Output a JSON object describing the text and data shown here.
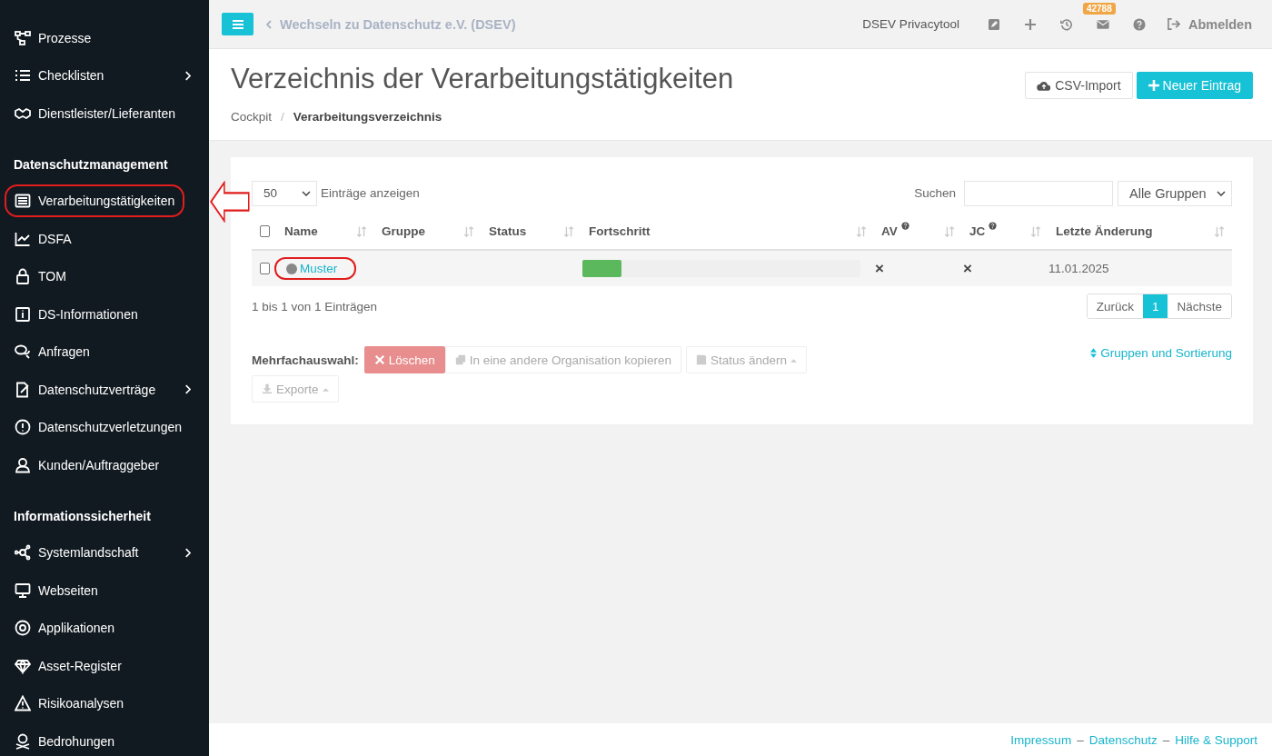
{
  "sidebar": {
    "sections": [
      {
        "items": [
          {
            "label": "Prozesse",
            "submenu": false,
            "highlighted": false
          },
          {
            "label": "Checklisten",
            "submenu": true,
            "highlighted": false
          },
          {
            "label": "Dienstleister/Lieferanten",
            "submenu": false,
            "highlighted": false
          }
        ]
      },
      {
        "heading": "Datenschutzmanagement",
        "items": [
          {
            "label": "Verarbeitungstätigkeiten",
            "submenu": false,
            "highlighted": true
          },
          {
            "label": "DSFA",
            "submenu": false,
            "highlighted": false
          },
          {
            "label": "TOM",
            "submenu": false,
            "highlighted": false
          },
          {
            "label": "DS-Informationen",
            "submenu": false,
            "highlighted": false
          },
          {
            "label": "Anfragen",
            "submenu": false,
            "highlighted": false
          },
          {
            "label": "Datenschutzverträge",
            "submenu": true,
            "highlighted": false
          },
          {
            "label": "Datenschutzverletzungen",
            "submenu": false,
            "highlighted": false
          },
          {
            "label": "Kunden/Auftraggeber",
            "submenu": false,
            "highlighted": false
          }
        ]
      },
      {
        "heading": "Informationssicherheit",
        "items": [
          {
            "label": "Systemlandschaft",
            "submenu": true,
            "highlighted": false
          },
          {
            "label": "Webseiten",
            "submenu": false,
            "highlighted": false
          },
          {
            "label": "Applikationen",
            "submenu": false,
            "highlighted": false
          },
          {
            "label": "Asset-Register",
            "submenu": false,
            "highlighted": false
          },
          {
            "label": "Risikoanalysen",
            "submenu": false,
            "highlighted": false
          },
          {
            "label": "Bedrohungen",
            "submenu": false,
            "highlighted": false
          }
        ]
      }
    ]
  },
  "topbar": {
    "back_link": "Wechseln zu Datenschutz e.V. (DSEV)",
    "app_name": "DSEV Privacytool",
    "mail_badge": "42788",
    "logout": "Abmelden"
  },
  "page": {
    "title": "Verzeichnis der Verarbeitungstätigkeiten",
    "breadcrumb": [
      {
        "label": "Cockpit",
        "kind": "link",
        "current": false
      },
      {
        "label": "/",
        "kind": "separator"
      },
      {
        "label": "Verarbeitungsverzeichnis",
        "kind": "link",
        "current": true
      }
    ],
    "actions": [
      {
        "label": "CSV-Import",
        "kind": "secondary"
      },
      {
        "label": "Neuer Eintrag",
        "kind": "primary"
      }
    ]
  },
  "table_controls": {
    "page_size": "50",
    "page_size_label": "Einträge anzeigen",
    "search_label": "Suchen",
    "group_filter": "Alle Gruppen"
  },
  "table": {
    "select_all_checked": false,
    "columns": [
      {
        "label": "Name",
        "help": false
      },
      {
        "label": "Gruppe",
        "help": false
      },
      {
        "label": "Status",
        "help": false
      },
      {
        "label": "Fortschritt",
        "help": false
      },
      {
        "label": "AV",
        "help": true
      },
      {
        "label": "JC",
        "help": true
      },
      {
        "label": "Letzte Änderung",
        "help": false
      }
    ],
    "rows": [
      {
        "checked": false,
        "color": "#888888",
        "name": "Muster",
        "highlighted": true,
        "level": 0.14,
        "av": "×",
        "jc": "×",
        "changed": "11.01.2025"
      }
    ]
  },
  "info": "1 bis 1 von 1 Einträgen",
  "pagination": [
    {
      "label": "Zurück",
      "selected": false
    },
    {
      "label": "1",
      "selected": true
    },
    {
      "label": "Nächste",
      "selected": false
    }
  ],
  "bulk": {
    "label": "Mehrfachauswahl:",
    "actions": [
      {
        "label": "Löschen",
        "kind": "danger",
        "dropdown": false
      },
      {
        "label": "In eine andere Organisation kopieren",
        "kind": "disabled",
        "dropdown": false
      },
      {
        "label": "Status ändern",
        "kind": "disabled",
        "dropdown": true
      },
      {
        "label": "Exporte",
        "kind": "disabled",
        "dropdown": true
      }
    ]
  },
  "group_sort_link": "Gruppen und Sortierung",
  "footer": [
    {
      "label": "Impressum",
      "kind": "link"
    },
    {
      "label": "–",
      "kind": "separator"
    },
    {
      "label": "Datenschutz",
      "kind": "link"
    },
    {
      "label": "–",
      "kind": "separator"
    },
    {
      "label": "Hilfe & Support",
      "kind": "link"
    }
  ]
}
